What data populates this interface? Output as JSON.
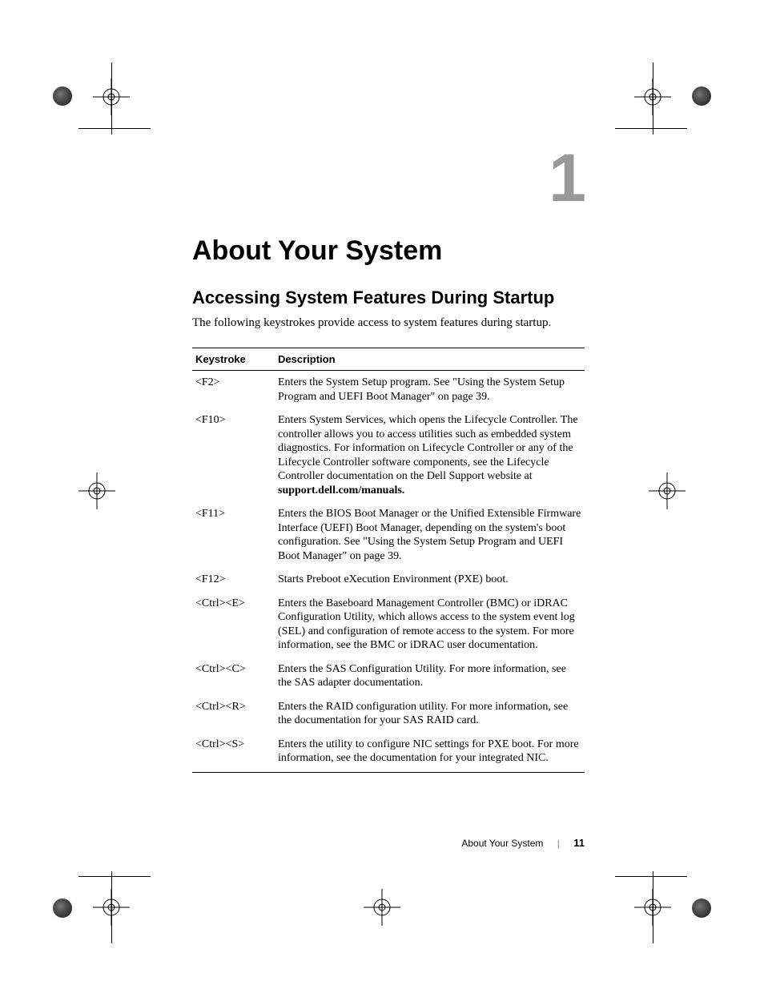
{
  "chapter": {
    "number": "1",
    "title": "About Your System"
  },
  "section": {
    "title": "Accessing System Features During Startup",
    "intro": "The following keystrokes provide access to system features during startup."
  },
  "table": {
    "headers": {
      "col1": "Keystroke",
      "col2": "Description"
    },
    "rows": [
      {
        "key": "<F2>",
        "desc": "Enters the System Setup program. See \"Using the System Setup Program and UEFI Boot Manager\" on page 39.",
        "bold_suffix": null
      },
      {
        "key": "<F10>",
        "desc": "Enters System Services, which opens the Lifecycle Controller. The controller allows you to access utilities such as embedded system diagnostics. For information on Lifecycle Controller or any of the Lifecycle Controller software components, see the Lifecycle Controller documentation on the Dell Support website at ",
        "bold_suffix": "support.dell.com/manuals."
      },
      {
        "key": "<F11>",
        "desc": "Enters the BIOS Boot Manager or the Unified Extensible Firmware Interface (UEFI) Boot Manager, depending on the system's boot configuration. See \"Using the System Setup Program and UEFI Boot Manager\" on page 39.",
        "bold_suffix": null
      },
      {
        "key": "<F12>",
        "desc": "Starts Preboot eXecution Environment (PXE) boot.",
        "bold_suffix": null
      },
      {
        "key": "<Ctrl><E>",
        "desc": "Enters the Baseboard Management Controller (BMC) or iDRAC Configuration Utility, which allows access to the system event log (SEL) and configuration of remote access to the system. For more information, see the BMC or iDRAC user documentation.",
        "bold_suffix": null
      },
      {
        "key": "<Ctrl><C>",
        "desc": "Enters the SAS Configuration Utility. For more information, see the SAS adapter documentation.",
        "bold_suffix": null
      },
      {
        "key": "<Ctrl><R>",
        "desc": "Enters the RAID configuration utility. For more information, see the documentation for your SAS RAID card.",
        "bold_suffix": null
      },
      {
        "key": "<Ctrl><S>",
        "desc": "Enters the utility to configure NIC settings for PXE boot. For more information, see the documentation for your integrated NIC.",
        "bold_suffix": null
      }
    ]
  },
  "footer": {
    "title": "About Your System",
    "page": "11"
  }
}
